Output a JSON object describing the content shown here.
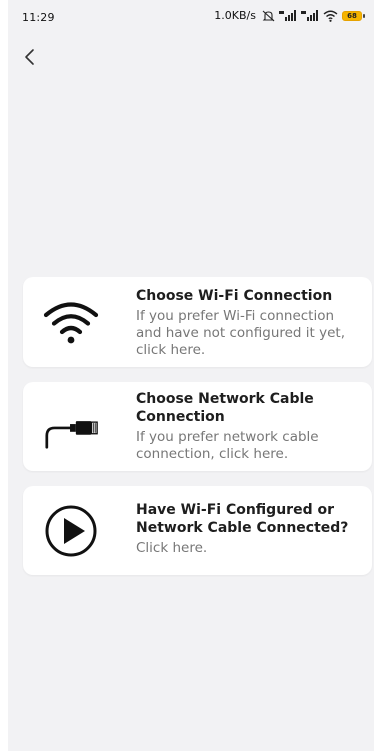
{
  "status_bar": {
    "time": "11:29",
    "speed": "1.0KB/s",
    "battery": "68",
    "accent_color": "#f5b400"
  },
  "nav": {
    "back_icon": "chevron-left-icon"
  },
  "options": [
    {
      "icon": "wifi-icon",
      "title": "Choose Wi-Fi Connection",
      "description": "If you prefer Wi-Fi connection and have not configured it yet, click here."
    },
    {
      "icon": "network-cable-icon",
      "title": "Choose Network Cable Connection",
      "description": "If you prefer network cable connection, click here."
    },
    {
      "icon": "play-circle-icon",
      "title": "Have Wi-Fi Configured or Network Cable Connected?",
      "description": "Click here."
    }
  ],
  "colors": {
    "background": "#f2f2f4",
    "card": "#ffffff",
    "title_text": "#1e1e1e",
    "desc_text": "#777777"
  }
}
